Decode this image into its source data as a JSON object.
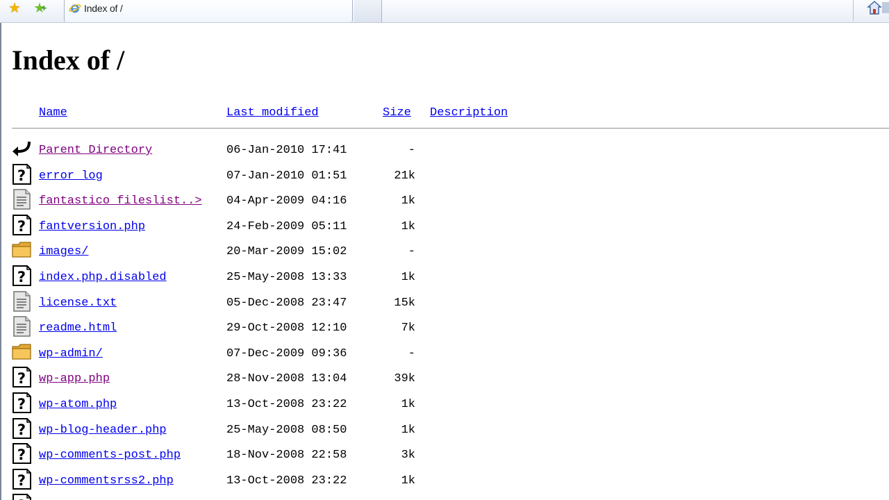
{
  "browser": {
    "tab_title": "Index of /"
  },
  "page": {
    "heading": "Index of /",
    "columns": {
      "name": "Name",
      "last_modified": "Last modified",
      "size": "Size",
      "description": "Description"
    },
    "rows": [
      {
        "icon": "parent-directory-icon",
        "name": "Parent Directory",
        "date": "06-Jan-2010 17:41",
        "size": "-",
        "visited": true
      },
      {
        "icon": "unknown-file-icon",
        "name": "error_log",
        "date": "07-Jan-2010 01:51",
        "size": "21k",
        "visited": false
      },
      {
        "icon": "text-file-icon",
        "name": "fantastico_fileslist..>",
        "date": "04-Apr-2009 04:16",
        "size": "1k",
        "visited": true
      },
      {
        "icon": "unknown-file-icon",
        "name": "fantversion.php",
        "date": "24-Feb-2009 05:11",
        "size": "1k",
        "visited": false
      },
      {
        "icon": "folder-icon",
        "name": "images/",
        "date": "20-Mar-2009 15:02",
        "size": "-",
        "visited": false
      },
      {
        "icon": "unknown-file-icon",
        "name": "index.php.disabled",
        "date": "25-May-2008 13:33",
        "size": "1k",
        "visited": false
      },
      {
        "icon": "text-file-icon",
        "name": "license.txt",
        "date": "05-Dec-2008 23:47",
        "size": "15k",
        "visited": false
      },
      {
        "icon": "text-file-icon",
        "name": "readme.html",
        "date": "29-Oct-2008 12:10",
        "size": "7k",
        "visited": false
      },
      {
        "icon": "folder-icon",
        "name": "wp-admin/",
        "date": "07-Dec-2009 09:36",
        "size": "-",
        "visited": false
      },
      {
        "icon": "unknown-file-icon",
        "name": "wp-app.php",
        "date": "28-Nov-2008 13:04",
        "size": "39k",
        "visited": true
      },
      {
        "icon": "unknown-file-icon",
        "name": "wp-atom.php",
        "date": "13-Oct-2008 23:22",
        "size": "1k",
        "visited": false
      },
      {
        "icon": "unknown-file-icon",
        "name": "wp-blog-header.php",
        "date": "25-May-2008 08:50",
        "size": "1k",
        "visited": false
      },
      {
        "icon": "unknown-file-icon",
        "name": "wp-comments-post.php",
        "date": "18-Nov-2008 22:58",
        "size": "3k",
        "visited": false
      },
      {
        "icon": "unknown-file-icon",
        "name": "wp-commentsrss2.php",
        "date": "13-Oct-2008 23:22",
        "size": "1k",
        "visited": false
      },
      {
        "icon": "unknown-file-icon",
        "name": "",
        "date": "",
        "size": "",
        "visited": false
      }
    ]
  }
}
